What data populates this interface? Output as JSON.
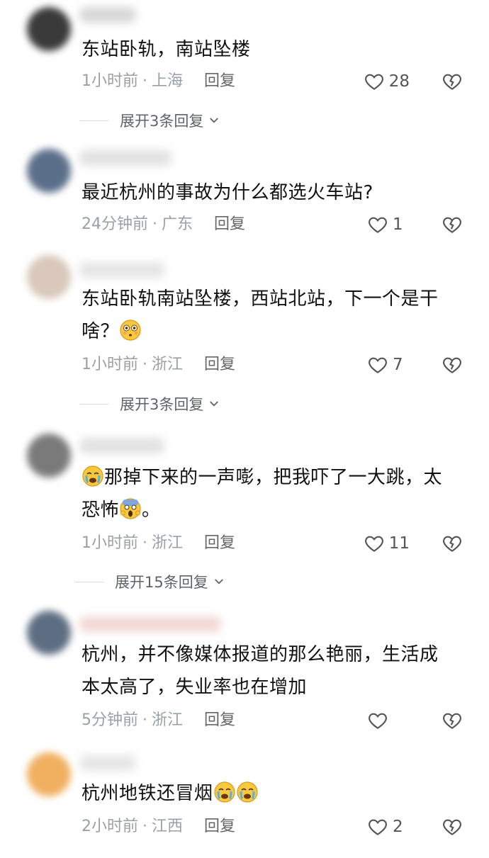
{
  "comments": [
    {
      "text": "东站卧轨，南站坠楼",
      "time": "1小时前",
      "location": "上海",
      "reply": "回复",
      "likes": "28",
      "expand": "展开3条回复"
    },
    {
      "text": "最近杭州的事故为什么都选火车站?",
      "time": "24分钟前",
      "location": "广东",
      "reply": "回复",
      "likes": "1"
    },
    {
      "text_line1": "东站卧轨南站坠楼，西站北站，下一个是干",
      "text_line2": "啥？",
      "emoji": "flushed-face-emoji",
      "time": "1小时前",
      "location": "浙江",
      "reply": "回复",
      "likes": "7",
      "expand": "展开3条回复"
    },
    {
      "emoji_lead": "crying-face-emoji",
      "text_line1": "那掉下来的一声嘭，把我吓了一大跳，太",
      "text_line2": "恐怖",
      "emoji_mid": "screaming-face-emoji",
      "text_tail": "。",
      "time": "1小时前",
      "location": "浙江",
      "reply": "回复",
      "likes": "11",
      "expand": "展开15条回复"
    },
    {
      "text_line1": "杭州，并不像媒体报道的那么艳丽，生活成",
      "text_line2": "本太高了，失业率也在增加",
      "time": "5分钟前",
      "location": "浙江",
      "reply": "回复",
      "likes": ""
    },
    {
      "text": "杭州地铁还冒烟",
      "emoji": "crying-face-emoji",
      "time": "2小时前",
      "location": "江西",
      "reply": "回复",
      "likes": "2"
    }
  ],
  "separator": "·",
  "colors": {
    "text": "#111111",
    "meta": "#9aa0a6",
    "icon": "#555555"
  }
}
